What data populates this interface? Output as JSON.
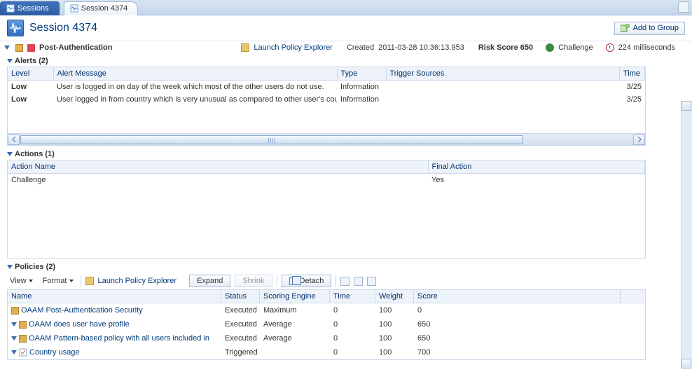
{
  "tabs": {
    "sessions": "Sessions",
    "session_detail": "Session 4374"
  },
  "header": {
    "title": "Session 4374",
    "add_to_group": "Add to Group"
  },
  "subheader": {
    "title": "Post-Authentication",
    "launch_policy_explorer": "Launch Policy Explorer",
    "created_label": "Created",
    "created_value": "2011-03-28 10:36:13.953",
    "risk_label": "Risk Score",
    "risk_value": "650",
    "challenge_label": "Challenge",
    "elapsed": "224 milliseconds"
  },
  "alerts": {
    "title": "Alerts (2)",
    "cols": {
      "level": "Level",
      "message": "Alert Message",
      "type": "Type",
      "trigger": "Trigger Sources",
      "time": "Time"
    },
    "rows": [
      {
        "level": "Low",
        "message": "User is logged in on day of the week which most of the other users do not use.",
        "type": "Information",
        "trigger": "",
        "time": "3/25"
      },
      {
        "level": "Low",
        "message": "User logged in from country which is very unusual as compared to other user's coun",
        "type": "Information",
        "trigger": "",
        "time": "3/25"
      }
    ]
  },
  "actions": {
    "title": "Actions (1)",
    "cols": {
      "name": "Action Name",
      "final": "Final Action"
    },
    "rows": [
      {
        "name": "Challenge",
        "final": "Yes"
      }
    ]
  },
  "policies": {
    "title": "Policies (2)",
    "toolbar": {
      "view": "View",
      "format": "Format",
      "launch": "Launch Policy Explorer",
      "expand": "Expand",
      "shrink": "Shrink",
      "detach": "Detach"
    },
    "cols": {
      "name": "Name",
      "status": "Status",
      "engine": "Scoring Engine",
      "time": "Time",
      "weight": "Weight",
      "score": "Score"
    },
    "rows": [
      {
        "indent": 1,
        "name": "OAAM Post-Authentication Security",
        "status": "Executed",
        "engine": "Maximum",
        "time": "0",
        "weight": "100",
        "score": "0"
      },
      {
        "indent": 0,
        "name": "OAAM does user have profile",
        "status": "Executed",
        "engine": "Average",
        "time": "0",
        "weight": "100",
        "score": "650"
      },
      {
        "indent": 1,
        "name": "OAAM Pattern-based policy with all users included in",
        "status": "Executed",
        "engine": "Average",
        "time": "0",
        "weight": "100",
        "score": "650"
      },
      {
        "indent": 2,
        "name": "Country usage",
        "status": "Triggered",
        "engine": "",
        "time": "0",
        "weight": "100",
        "score": "700"
      }
    ]
  }
}
